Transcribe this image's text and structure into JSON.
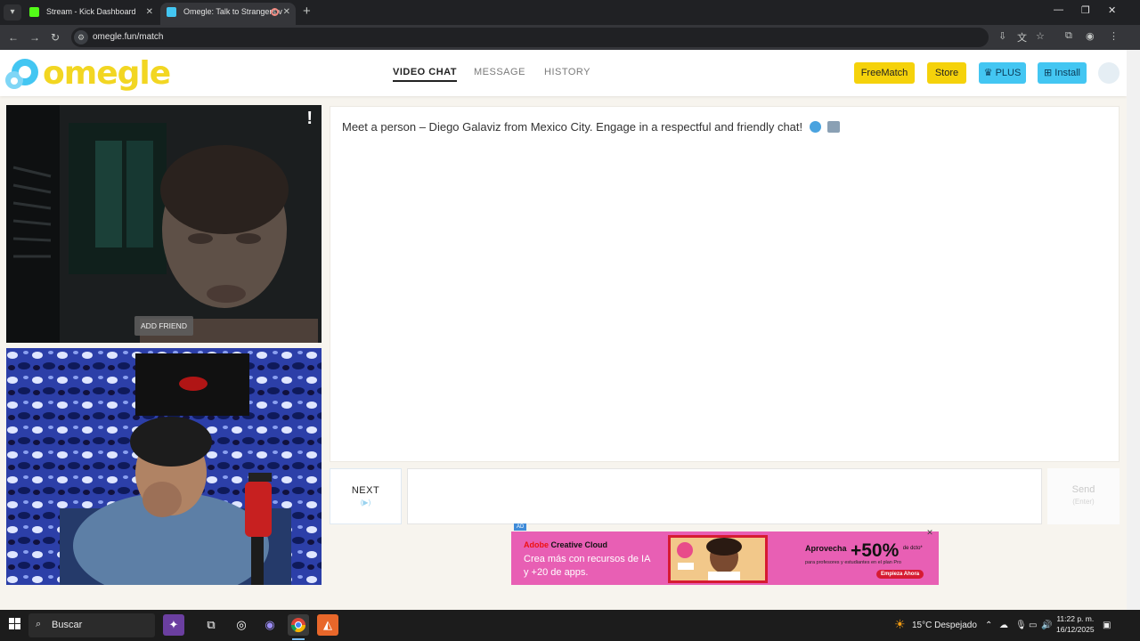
{
  "browser": {
    "tabs": [
      {
        "title": "Stream - Kick Dashboard",
        "active": false
      },
      {
        "title": "Omegle: Talk to Strangers v",
        "active": true
      }
    ],
    "url": "omegle.fun/match"
  },
  "header": {
    "logo_text": "omegle",
    "nav": [
      "VIDEO CHAT",
      "MESSAGE",
      "HISTORY"
    ],
    "nav_active": "VIDEO CHAT",
    "buttons": {
      "freematch": "FreeMatch",
      "store": "Store",
      "plus": "PLUS",
      "install": "Install"
    },
    "colors": {
      "brand_yellow": "#f5d20b",
      "brand_blue": "#43c6f2"
    }
  },
  "videos": {
    "report_label": "!",
    "add_friend_label": "ADD FRIEND"
  },
  "chat": {
    "message": "Meet a person – Diego Galaviz from Mexico City. Engage in a respectful and friendly chat!",
    "next_label": "NEXT",
    "next_sub": "(▶)",
    "send_label": "Send",
    "send_sub": "(Enter)"
  },
  "ad": {
    "badge": "AD",
    "brand_red": "Adobe",
    "brand_rest": "Creative Cloud",
    "line1": "Crea más con recursos de IA",
    "line2": "y +20 de apps.",
    "promo_lead": "Aprovecha",
    "promo_pct": "+50%",
    "promo_pct_sub": "de dcto*",
    "promo_small": "para profesores y estudiantes en el plan Pro",
    "cta": "Empieza Ahora"
  },
  "taskbar": {
    "search_placeholder": "Buscar",
    "weather": "15°C  Despejado",
    "time": "11:22 p. m.",
    "date": "16/12/2025"
  }
}
